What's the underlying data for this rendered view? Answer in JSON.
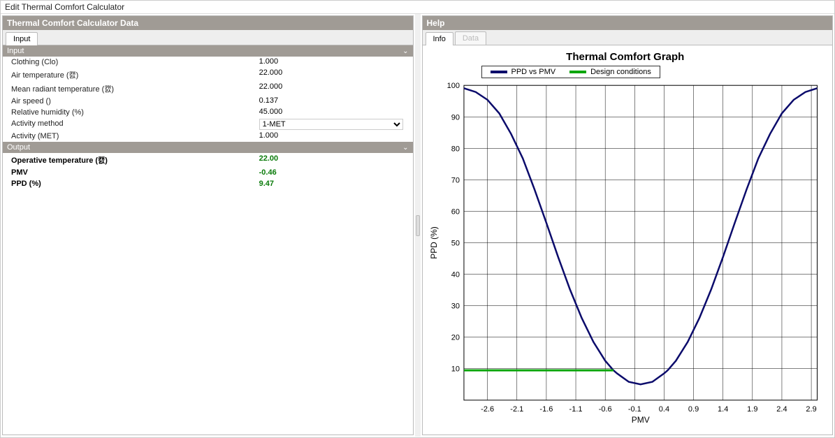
{
  "window_title": "Edit Thermal Comfort Calculator",
  "left": {
    "header": "Thermal Comfort Calculator Data",
    "tabs": [
      {
        "label": "Input",
        "active": true
      }
    ],
    "sections": {
      "input_header": "Input",
      "output_header": "Output"
    },
    "inputs": [
      {
        "label": "Clothing (Clo)",
        "value": "1.000",
        "type": "text"
      },
      {
        "label": "Air temperature (캜)",
        "value": "22.000",
        "type": "text"
      },
      {
        "label": "Mean radiant temperature (캜)",
        "value": "22.000",
        "type": "text"
      },
      {
        "label": "Air speed ()",
        "value": "0.137",
        "type": "text"
      },
      {
        "label": "Relative humidity (%)",
        "value": "45.000",
        "type": "text"
      },
      {
        "label": "Activity method",
        "value": "1-MET",
        "type": "select"
      },
      {
        "label": "Activity (MET)",
        "value": "1.000",
        "type": "text"
      }
    ],
    "outputs": [
      {
        "label": "Operative temperature (캜)",
        "value": "22.00"
      },
      {
        "label": "PMV",
        "value": "-0.46"
      },
      {
        "label": "PPD (%)",
        "value": "9.47"
      }
    ]
  },
  "right": {
    "header": "Help",
    "tabs": [
      {
        "label": "Info",
        "active": true
      },
      {
        "label": "Data",
        "disabled": true
      }
    ],
    "chart_title": "Thermal Comfort Graph",
    "legend": [
      {
        "label": "PPD vs PMV",
        "color": "#0b0b6b"
      },
      {
        "label": "Design conditions",
        "color": "#0aa60a"
      }
    ]
  },
  "chart_data": {
    "type": "line",
    "title": "Thermal Comfort Graph",
    "xlabel": "PMV",
    "ylabel": "PPD (%)",
    "xlim": [
      -3.0,
      3.0
    ],
    "ylim": [
      0,
      100
    ],
    "xticks": [
      -2.6,
      -2.1,
      -1.6,
      -1.1,
      -0.6,
      -0.1,
      0.4,
      0.9,
      1.4,
      1.9,
      2.4,
      2.9
    ],
    "yticks": [
      10,
      20,
      30,
      40,
      50,
      60,
      70,
      80,
      90,
      100
    ],
    "series": [
      {
        "name": "PPD vs PMV",
        "color": "#0b0b6b",
        "x": [
          -3.0,
          -2.8,
          -2.6,
          -2.4,
          -2.2,
          -2.0,
          -1.8,
          -1.6,
          -1.4,
          -1.2,
          -1.0,
          -0.8,
          -0.6,
          -0.46,
          -0.4,
          -0.2,
          0.0,
          0.2,
          0.4,
          0.46,
          0.6,
          0.8,
          1.0,
          1.2,
          1.4,
          1.6,
          1.8,
          2.0,
          2.2,
          2.4,
          2.6,
          2.8,
          3.0
        ],
        "y": [
          99.1,
          97.9,
          95.4,
          91.1,
          84.6,
          76.8,
          66.9,
          56.3,
          45.5,
          35.2,
          26.1,
          18.5,
          12.5,
          9.47,
          8.5,
          5.8,
          5.0,
          5.8,
          8.5,
          9.47,
          12.5,
          18.5,
          26.1,
          35.2,
          45.5,
          56.3,
          66.9,
          76.8,
          84.6,
          91.1,
          95.4,
          97.9,
          99.1
        ]
      },
      {
        "name": "Design conditions",
        "color": "#0aa60a",
        "x": [
          -3.0,
          -0.46
        ],
        "y": [
          9.47,
          9.47
        ]
      }
    ]
  }
}
